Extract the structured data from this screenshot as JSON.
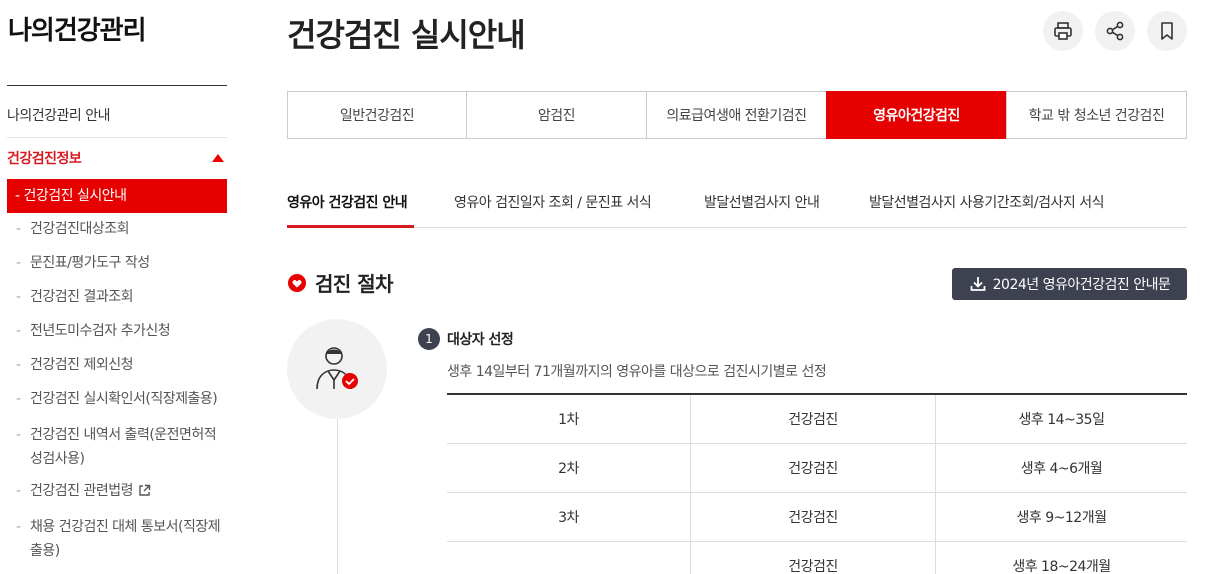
{
  "sidebar": {
    "title": "나의건강관리",
    "top_item": "나의건강관리 안내",
    "section": "건강검진정보",
    "active_item": "건강검진 실시안내",
    "items": [
      {
        "label": "건강검진대상조회",
        "ext": false
      },
      {
        "label": "문진표/평가도구 작성",
        "ext": false
      },
      {
        "label": "건강검진 결과조회",
        "ext": false
      },
      {
        "label": "전년도미수검자 추가신청",
        "ext": false
      },
      {
        "label": "건강검진 제외신청",
        "ext": false
      },
      {
        "label": "건강검진 실시확인서(직장제출용)",
        "ext": false
      },
      {
        "label": "건강검진 내역서 출력(운전면허적성검사용)",
        "ext": false
      },
      {
        "label": "건강검진 관련법령",
        "ext": true
      },
      {
        "label": "채용 건강검진 대체 통보서(직장제출용)",
        "ext": false
      }
    ]
  },
  "header": {
    "title": "건강검진 실시안내",
    "icons": [
      "print-icon",
      "share-icon",
      "bookmark-icon"
    ]
  },
  "tabs": [
    {
      "label": "일반건강검진",
      "active": false
    },
    {
      "label": "암검진",
      "active": false
    },
    {
      "label": "의료급여생애 전환기검진",
      "active": false
    },
    {
      "label": "영유아건강검진",
      "active": true
    },
    {
      "label": "학교 밖 청소년 건강검진",
      "active": false
    }
  ],
  "subtabs": [
    {
      "label": "영유아 건강검진 안내",
      "active": true
    },
    {
      "label": "영유아 검진일자 조회 / 문진표 서식",
      "active": false
    },
    {
      "label": "발달선별검사지 안내",
      "active": false
    },
    {
      "label": "발달선별검사지 사용기간조회/검사지 서식",
      "active": false
    }
  ],
  "section": {
    "title": "검진 절차",
    "download_label": "2024년 영유아건강검진 안내문"
  },
  "step": {
    "number": "1",
    "title": "대상자 선정",
    "desc": "생후 14일부터 71개월까지의 영유아를 대상으로 검진시기별로 선정",
    "rows": [
      [
        "1차",
        "건강검진",
        "생후 14~35일"
      ],
      [
        "2차",
        "건강검진",
        "생후 4~6개월"
      ],
      [
        "3차",
        "건강검진",
        "생후 9~12개월"
      ],
      [
        "",
        "건강검진",
        "생후 18~24개월"
      ]
    ]
  },
  "colors": {
    "accent": "#e60000",
    "dark": "#3d4150"
  }
}
